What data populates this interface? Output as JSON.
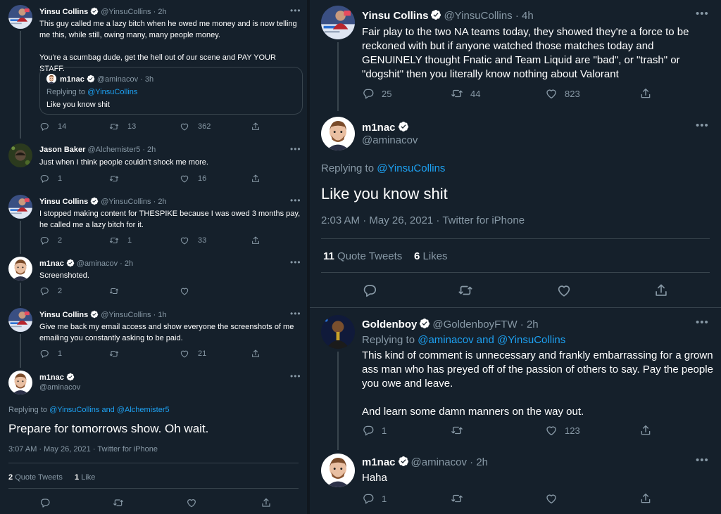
{
  "colors": {
    "background": "#15202b",
    "accent": "#1da1f2",
    "muted": "#8899a6",
    "divider": "#38444d"
  },
  "icons": [
    "reply-icon",
    "retweet-icon",
    "like-icon",
    "share-icon",
    "verified-icon",
    "more-icon"
  ],
  "more_label": "•••",
  "left": {
    "tweet1": {
      "name": "Yinsu Collins",
      "handle": "@YinsuCollins",
      "dot": "·",
      "time": "2h",
      "text": "This guy called me a lazy bitch when he owed me money and is now telling me this, while still, owing many, many people money.\n\nYou're a scumbag dude, get the hell out of our scene and PAY YOUR STAFF.",
      "quote": {
        "name": "m1nac",
        "handle": "@aminacov",
        "time": "3h",
        "replying_prefix": "Replying to",
        "replying_to": "@YinsuCollins",
        "text": "Like you know shit"
      },
      "replies": "14",
      "retweets": "13",
      "likes": "362"
    },
    "tweet2": {
      "name": "Jason Baker",
      "handle": "@Alchemister5",
      "dot": "·",
      "time": "2h",
      "text": "Just when I think people couldn't shock me more.",
      "replies": "1",
      "retweets": "",
      "likes": "16"
    },
    "tweet3": {
      "name": "Yinsu Collins",
      "handle": "@YinsuCollins",
      "dot": "·",
      "time": "2h",
      "text": "I stopped making content for THESPIKE because I was owed 3 months pay, he called me a lazy bitch for it.",
      "replies": "2",
      "retweets": "1",
      "likes": "33"
    },
    "tweet4": {
      "name": "m1nac",
      "handle": "@aminacov",
      "dot": "·",
      "time": "2h",
      "text": "Screenshoted.",
      "replies": "2",
      "retweets": "",
      "likes": ""
    },
    "tweet5": {
      "name": "Yinsu Collins",
      "handle": "@YinsuCollins",
      "dot": "·",
      "time": "1h",
      "text": "Give me back my email access and show everyone the screenshots of me emailing you constantly asking to be paid.",
      "replies": "1",
      "retweets": "",
      "likes": "21"
    },
    "main": {
      "name": "m1nac",
      "handle": "@aminacov",
      "replying_prefix": "Replying to",
      "replying_to": "@YinsuCollins and @Alchemister5",
      "text": "Prepare for tomorrows show. Oh wait.",
      "meta": "3:07 AM · May 26, 2021 · Twitter for iPhone",
      "quote_count": "2",
      "quote_label": "Quote Tweets",
      "like_count": "1",
      "like_label": "Like"
    }
  },
  "right": {
    "tweet1": {
      "name": "Yinsu Collins",
      "handle": "@YinsuCollins",
      "dot": "·",
      "time": "4h",
      "text": "Fair play to the two NA teams today, they showed they're a force to be reckoned with but if anyone watched those matches today and GENUINELY thought Fnatic and Team Liquid are \"bad\", or \"trash\" or \"dogshit\" then you literally know nothing about Valorant",
      "replies": "25",
      "retweets": "44",
      "likes": "823"
    },
    "main": {
      "name": "m1nac",
      "handle": "@aminacov",
      "replying_prefix": "Replying to",
      "replying_to": "@YinsuCollins",
      "text": "Like you know shit",
      "meta": "2:03 AM · May 26, 2021 · Twitter for iPhone",
      "quote_count": "11",
      "quote_label": "Quote Tweets",
      "like_count": "6",
      "like_label": "Likes"
    },
    "tweet2": {
      "name": "Goldenboy",
      "handle": "@GoldenboyFTW",
      "dot": "·",
      "time": "2h",
      "replying_prefix": "Replying to",
      "replying_to": "@aminacov and @YinsuCollins",
      "text": "This kind of comment is unnecessary and frankly embarrassing for a grown ass man who has preyed off of the passion of others to say. Pay the people you owe and leave.\n\nAnd learn some damn manners on the way out.",
      "replies": "1",
      "retweets": "",
      "likes": "123"
    },
    "tweet3": {
      "name": "m1nac",
      "handle": "@aminacov",
      "dot": "·",
      "time": "2h",
      "text": "Haha",
      "replies": "1",
      "retweets": "",
      "likes": ""
    }
  }
}
